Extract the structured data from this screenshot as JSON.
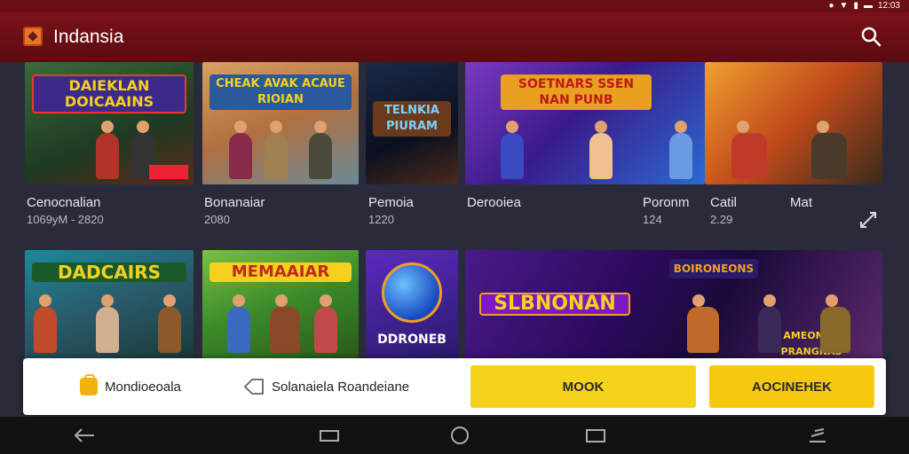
{
  "status_bar": {
    "time": "12:03"
  },
  "app_bar": {
    "title": "Indansia",
    "logo_icon": "app-logo-icon",
    "search_icon": "search-icon"
  },
  "games_row1": [
    {
      "banner": "DAIEKLAN DOICAAINS",
      "title": "Cenocnalian",
      "subtitle": "1069yM - 2820",
      "accent": "#c0392b"
    },
    {
      "banner": "CHEAK AVAK ACAUE RIOIAN",
      "title": "Bonanaiar",
      "subtitle": "2080",
      "accent": "#f2c230"
    },
    {
      "banner": "TELNKIA PIURAM",
      "title": "Pemoia",
      "subtitle": "1220",
      "accent": "#3aa0e8"
    },
    {
      "banner": "SOETNARS SSEN NAN PUNB",
      "title": "Derooiea",
      "subtitle": "",
      "accent": "#ff7a2a"
    },
    {
      "banner": "",
      "title": "Poronm",
      "subtitle": "124",
      "accent": "#d98b2a"
    },
    {
      "banner": "",
      "title": "Catil",
      "subtitle": "2.29",
      "accent": "#f0a030"
    },
    {
      "banner": "",
      "title": "Mat",
      "subtitle": "",
      "accent": "#e08a20"
    }
  ],
  "games_row2": [
    {
      "banner": "DADCAIRS",
      "accent": "#2ad0b8"
    },
    {
      "banner": "MEMAAIAR",
      "accent": "#e04a1a"
    },
    {
      "banner": "DDRONEB",
      "accent": "#3a5fe0"
    },
    {
      "banner": "SLBNONAN",
      "accent": "#f2c230"
    },
    {
      "banner": "BOIRONEONS",
      "accent": "#e8a020"
    },
    {
      "banner": "AMEOMER PRANGNAS",
      "accent": "#f2c230"
    }
  ],
  "expand_icon": "expand-icon",
  "action_sheet": {
    "option1": "Mondioeoala",
    "option2": "Solanaiela Roandeiane",
    "button_primary": "MOOK",
    "button_secondary": "AOCINEHEK"
  },
  "nav": {
    "back_icon": "back-icon",
    "recents_icon": "recents-icon",
    "home_icon": "home-icon",
    "overview_icon": "overview-icon",
    "menu_icon": "menu-icon"
  }
}
